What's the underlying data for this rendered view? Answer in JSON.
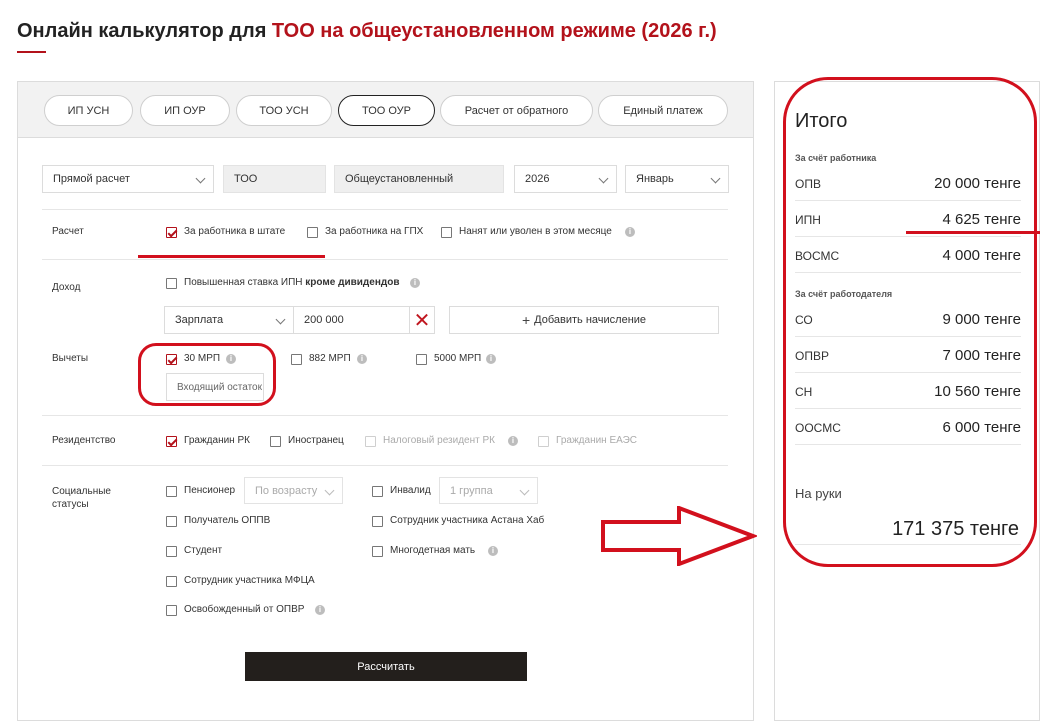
{
  "page": {
    "title_plain": "Онлайн калькулятор для ",
    "title_accent": "ТОО на общеустановленном режиме (2026 г.)"
  },
  "tabs": [
    {
      "label": "ИП УСН"
    },
    {
      "label": "ИП ОУР"
    },
    {
      "label": "ТОО УСН"
    },
    {
      "label": "ТОО ОУР",
      "active": true
    },
    {
      "label": "Расчет от обратного"
    },
    {
      "label": "Единый платеж"
    }
  ],
  "filters": {
    "calc_type": "Прямой расчет",
    "entity": "ТОО",
    "regime": "Общеустановленный",
    "year": "2026",
    "month": "Январь"
  },
  "calculation": {
    "label": "Расчет",
    "options": [
      {
        "label": "За работника в штате",
        "checked": true
      },
      {
        "label": "За работника на ГПХ",
        "checked": false
      },
      {
        "label": "Нанят или уволен в этом месяце",
        "checked": false
      }
    ]
  },
  "income": {
    "label": "Доход",
    "rate_option_plain": "Повышенная ставка ИПН ",
    "rate_option_bold": "кроме дивидендов",
    "income_type": "Зарплата",
    "amount": "200 000",
    "add_button": "Добавить начисление"
  },
  "deductions": {
    "label": "Вычеты",
    "options": [
      {
        "label": "30 МРП",
        "checked": true
      },
      {
        "label": "882 МРП",
        "checked": false
      },
      {
        "label": "5000 МРП",
        "checked": false
      }
    ],
    "balance_placeholder": "Входящий остаток"
  },
  "residency": {
    "label": "Резидентство",
    "options": [
      {
        "label": "Гражданин РК",
        "checked": true
      },
      {
        "label": "Иностранец",
        "checked": false
      },
      {
        "label": "Налоговый резидент РК",
        "checked": false,
        "disabled": true
      },
      {
        "label": "Гражданин ЕАЭС",
        "checked": false,
        "disabled": true
      }
    ]
  },
  "social": {
    "label_line1": "Социальные",
    "label_line2": "статусы",
    "pensioner": "Пенсионер",
    "pensioner_select": "По возрасту",
    "disabled": "Инвалид",
    "disabled_select": "1 группа",
    "oppv": "Получатель ОППВ",
    "astana_hub": "Сотрудник участника Астана Хаб",
    "student": "Студент",
    "large_family": "Многодетная мать",
    "mfca": "Сотрудник участника МФЦА",
    "opvr_exempt": "Освобожденный от ОПВР"
  },
  "calculate_button": "Рассчитать",
  "summary": {
    "title": "Итого",
    "employee_section": "За счёт работника",
    "employee_rows": [
      {
        "key": "ОПВ",
        "value": "20 000 тенге"
      },
      {
        "key": "ИПН",
        "value": "4 625 тенге"
      },
      {
        "key": "ВОСМС",
        "value": "4 000 тенге"
      }
    ],
    "employer_section": "За счёт работодателя",
    "employer_rows": [
      {
        "key": "СО",
        "value": "9 000 тенге"
      },
      {
        "key": "ОПВР",
        "value": "7 000 тенге"
      },
      {
        "key": "СН",
        "value": "10 560 тенге"
      },
      {
        "key": "ООСМС",
        "value": "6 000 тенге"
      }
    ],
    "net_label": "На руки",
    "net_value": "171 375 тенге"
  },
  "colors": {
    "accent": "#b3121b",
    "annotation": "#d2101d",
    "button_dark": "#231f1c"
  },
  "icons": {
    "info": "info-circle-icon",
    "chevron": "chevron-down-icon",
    "clear": "close-icon",
    "add": "plus-icon",
    "check": "checkmark-icon"
  }
}
